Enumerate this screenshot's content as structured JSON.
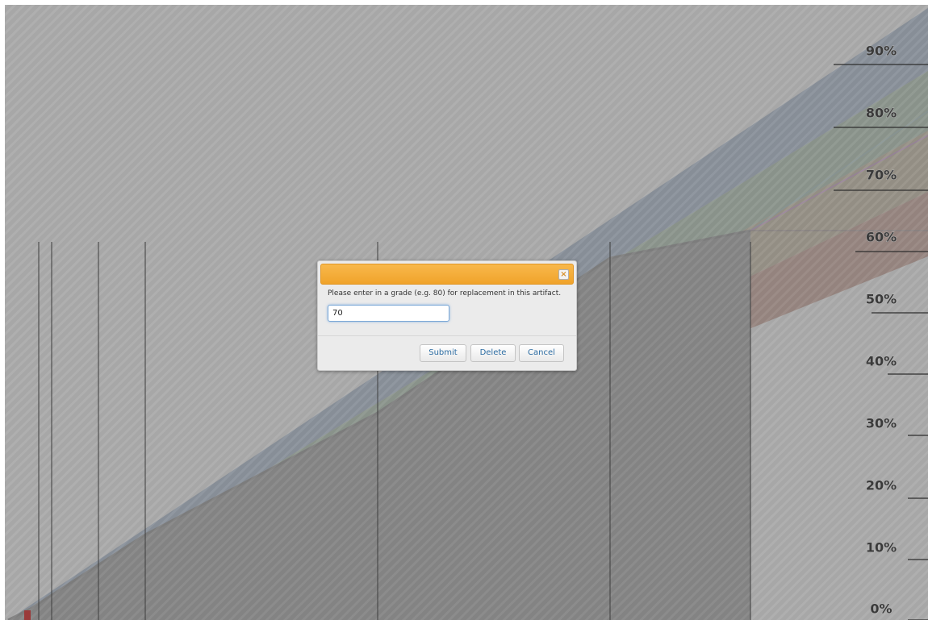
{
  "chart_data": {
    "type": "area",
    "y_ticks": [
      "90%",
      "80%",
      "70%",
      "60%",
      "50%",
      "40%",
      "30%",
      "20%",
      "10%",
      "0%"
    ],
    "bands": [
      {
        "color": "#6f8fb8"
      },
      {
        "color": "#78a07e"
      },
      {
        "color": "#a58f62"
      },
      {
        "color": "#a85e45"
      }
    ],
    "progress_series": {
      "color": "#3d3d3d"
    },
    "target_lines": [
      {
        "color": "#6fa3a0"
      },
      {
        "color": "#b055b8"
      }
    ],
    "overlay": "striped-gray"
  },
  "dialog": {
    "message": "Please enter in a grade (e.g. 80) for replacement in this artifact.",
    "input_value": "70",
    "close_symbol": "×",
    "submit_label": "Submit",
    "delete_label": "Delete",
    "cancel_label": "Cancel"
  }
}
